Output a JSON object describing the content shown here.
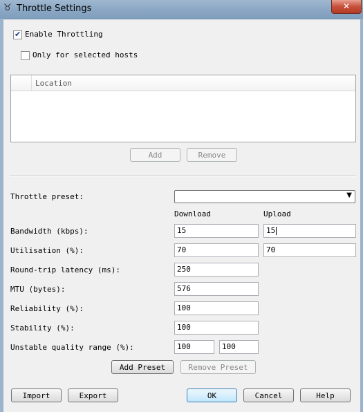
{
  "window": {
    "title": "Throttle Settings",
    "close_label": "✕"
  },
  "enable_throttling": {
    "label": "Enable Throttling",
    "checked": true
  },
  "only_selected_hosts": {
    "label": "Only for selected hosts",
    "checked": false
  },
  "hosts_list": {
    "column_header": "Location"
  },
  "hosts_buttons": {
    "add": "Add",
    "remove": "Remove"
  },
  "preset": {
    "label": "Throttle preset:",
    "value": ""
  },
  "columns": {
    "download": "Download",
    "upload": "Upload"
  },
  "fields": {
    "bandwidth": {
      "label": "Bandwidth (kbps):",
      "download": "15",
      "upload": "15"
    },
    "utilisation": {
      "label": "Utilisation (%):",
      "download": "70",
      "upload": "70"
    },
    "latency": {
      "label": "Round-trip latency (ms):",
      "value": "250"
    },
    "mtu": {
      "label": "MTU (bytes):",
      "value": "576"
    },
    "reliability": {
      "label": "Reliability (%):",
      "value": "100"
    },
    "stability": {
      "label": "Stability (%):",
      "value": "100"
    },
    "unstable_range": {
      "label": "Unstable quality range (%):",
      "min": "100",
      "max": "100"
    }
  },
  "preset_buttons": {
    "add": "Add Preset",
    "remove": "Remove Preset"
  },
  "footer": {
    "import": "Import",
    "export": "Export",
    "ok": "OK",
    "cancel": "Cancel",
    "help": "Help"
  }
}
